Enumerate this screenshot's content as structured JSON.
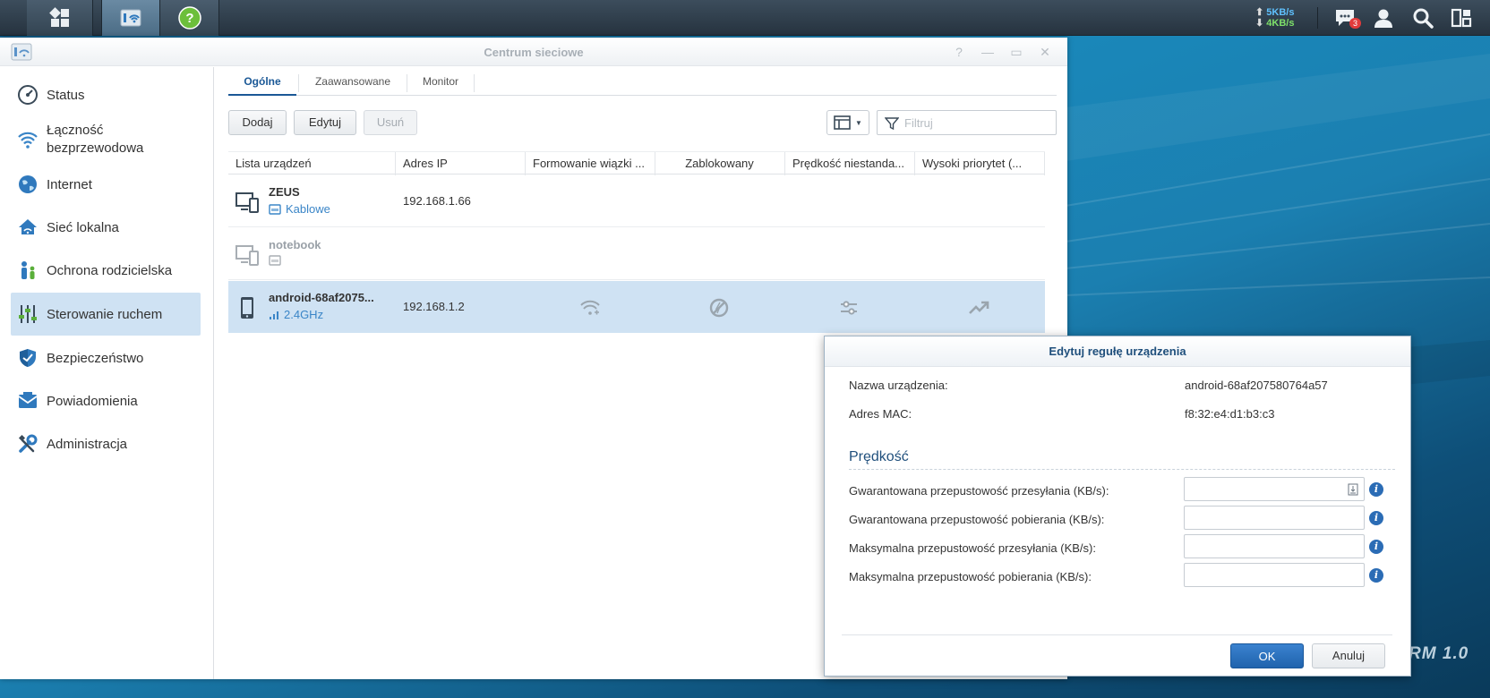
{
  "taskbar": {
    "speed_up": "5KB/s",
    "speed_down": "4KB/s",
    "notification_count": "3"
  },
  "window": {
    "title": "Centrum sieciowe",
    "controls": {
      "help": "?",
      "minimize": "—",
      "maximize": "▭",
      "close": "✕"
    }
  },
  "sidebar": {
    "items": [
      {
        "label": "Status",
        "icon": "gauge-icon"
      },
      {
        "label": "Łączność bezprzewodowa",
        "icon": "wifi-icon"
      },
      {
        "label": "Internet",
        "icon": "globe-icon"
      },
      {
        "label": "Sieć lokalna",
        "icon": "home-network-icon"
      },
      {
        "label": "Ochrona rodzicielska",
        "icon": "family-icon"
      },
      {
        "label": "Sterowanie ruchem",
        "icon": "sliders-icon",
        "active": true
      },
      {
        "label": "Bezpieczeństwo",
        "icon": "shield-icon"
      },
      {
        "label": "Powiadomienia",
        "icon": "envelope-icon"
      },
      {
        "label": "Administracja",
        "icon": "tools-icon"
      }
    ]
  },
  "tabs": [
    "Ogólne",
    "Zaawansowane",
    "Monitor"
  ],
  "toolbar": {
    "add": "Dodaj",
    "edit": "Edytuj",
    "delete": "Usuń",
    "filter_placeholder": "Filtruj"
  },
  "table": {
    "columns": [
      "Lista urządzeń",
      "Adres IP",
      "Formowanie wiązki ...",
      "Zablokowany",
      "Prędkość niestanda...",
      "Wysoki priorytet (..."
    ],
    "rows": [
      {
        "name": "ZEUS",
        "connection": "Kablowe",
        "ip": "192.168.1.66",
        "online": true
      },
      {
        "name": "notebook",
        "connection": "",
        "ip": "",
        "online": false
      },
      {
        "name": "android-68af2075...",
        "connection": "2.4GHz",
        "ip": "192.168.1.2",
        "online": true,
        "selected": true
      }
    ]
  },
  "dialog": {
    "title": "Edytuj regułę urządzenia",
    "device_name_label": "Nazwa urządzenia:",
    "device_name_value": "android-68af207580764a57",
    "mac_label": "Adres MAC:",
    "mac_value": "f8:32:e4:d1:b3:c3",
    "section_title": "Prędkość",
    "fields": [
      {
        "label": "Gwarantowana przepustowość przesyłania (KB/s):",
        "value": ""
      },
      {
        "label": "Gwarantowana przepustowość pobierania (KB/s):",
        "value": ""
      },
      {
        "label": "Maksymalna przepustowość przesyłania (KB/s):",
        "value": ""
      },
      {
        "label": "Maksymalna przepustowość pobierania (KB/s):",
        "value": ""
      }
    ],
    "ok": "OK",
    "cancel": "Anuluj"
  },
  "desktop": {
    "watermark": "RM 1.0"
  }
}
